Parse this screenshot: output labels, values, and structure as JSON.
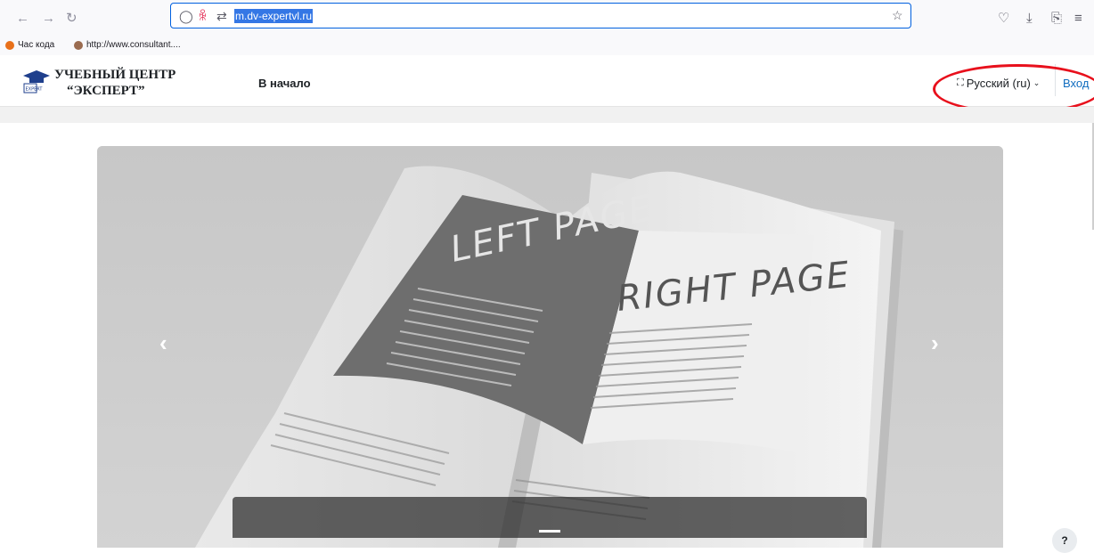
{
  "browser": {
    "url": "m.dv-expertvl.ru",
    "bookmarks": [
      {
        "label": "Час кода",
        "color": "#e8701a"
      },
      {
        "label": "http://www.consultant....",
        "color": "#9a6b4f"
      }
    ]
  },
  "site": {
    "logo_line1": "УЧЕБНЫЙ ЦЕНТР",
    "logo_line2": "“ЭКСПЕРТ”",
    "logo_badge": "EXPERT",
    "nav_home": "В начало",
    "language": "Русский (ru)",
    "login": "Вход"
  },
  "carousel": {
    "left_page_title": "LEFT PAGE",
    "right_page_title": "RIGHT PAGE",
    "prev_icon": "chevron-left-icon",
    "next_icon": "chevron-right-icon"
  },
  "help": {
    "label": "?"
  },
  "colors": {
    "link": "#0f6cbf",
    "annotation": "#e8101c",
    "url_highlight": "#3477e5"
  }
}
